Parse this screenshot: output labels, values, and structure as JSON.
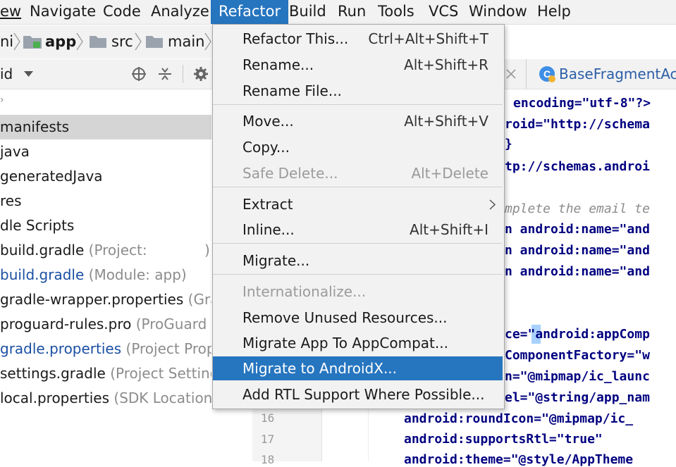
{
  "menubar": {
    "items": [
      "ew",
      "Navigate",
      "Code",
      "Analyze",
      "Refactor",
      "Build",
      "Run",
      "Tools",
      "VCS",
      "Window",
      "Help"
    ],
    "active": "Refactor"
  },
  "breadcrumb": {
    "items": [
      "ni",
      "app",
      "src",
      "main"
    ]
  },
  "project_view": {
    "selector_label": "id"
  },
  "tree": [
    {
      "name": "manifests",
      "hint": ""
    },
    {
      "name": "java",
      "hint": ""
    },
    {
      "name": "generatedJava",
      "hint": ""
    },
    {
      "name": "res",
      "hint": ""
    },
    {
      "name": "dle Scripts",
      "hint": ""
    },
    {
      "name": "build.gradle",
      "hint": "(Project:",
      "hint2": ")"
    },
    {
      "name": "build.gradle",
      "hint": "(Module: app)"
    },
    {
      "name": "gradle-wrapper.properties",
      "hint": "(Gradle"
    },
    {
      "name": "proguard-rules.pro",
      "hint": "(ProGuard Ru"
    },
    {
      "name": "gradle.properties",
      "hint": "(Project Proper"
    },
    {
      "name": "settings.gradle",
      "hint": "(Project Settings)"
    },
    {
      "name": "local.properties",
      "hint": "(SDK Location)"
    }
  ],
  "editor_tab": {
    "title": "BaseFragmentActi"
  },
  "code_lines": [
    "encoding=\"utf-8\"?>",
    "roid=\"http://schema",
    "}",
    "tp://schemas.androi",
    "",
    "mplete the email te",
    "n android:name=\"and",
    "n android:name=\"and",
    "n android:name=\"and",
    "",
    "ce=\"android:appComp",
    "ComponentFactory=\"w",
    "n=\"@mipmap/ic_launc",
    "el=\"@string/app_nam",
    "android:roundIcon=\"@mipmap/ic_",
    "android:supportsRtl=\"true\"",
    "android:theme=\"@style/AppTheme"
  ],
  "line_numbers": [
    "16",
    "17",
    "18"
  ],
  "refactor_menu": {
    "items": [
      {
        "label": "Refactor This...",
        "shortcut": "Ctrl+Alt+Shift+T"
      },
      {
        "label": "Rename...",
        "shortcut": "Alt+Shift+R"
      },
      {
        "label": "Rename File...",
        "shortcut": ""
      },
      {
        "label": "Move...",
        "shortcut": "Alt+Shift+V"
      },
      {
        "label": "Copy...",
        "shortcut": ""
      },
      {
        "label": "Safe Delete...",
        "shortcut": "Alt+Delete",
        "disabled": true
      },
      {
        "label": "Extract",
        "shortcut": "",
        "submenu": true
      },
      {
        "label": "Inline...",
        "shortcut": "Alt+Shift+I"
      },
      {
        "label": "Migrate...",
        "shortcut": ""
      },
      {
        "label": "Internationalize...",
        "shortcut": "",
        "disabled": true
      },
      {
        "label": "Remove Unused Resources...",
        "shortcut": ""
      },
      {
        "label": "Migrate App To AppCompat...",
        "shortcut": ""
      },
      {
        "label": "Migrate to AndroidX...",
        "shortcut": "",
        "highlighted": true
      },
      {
        "label": "Add RTL Support Where Possible...",
        "shortcut": ""
      }
    ]
  },
  "colors": {
    "accent": "#2675bf",
    "menu_bg": "#f2f2f2",
    "selected_row": "#d5d5d5"
  }
}
